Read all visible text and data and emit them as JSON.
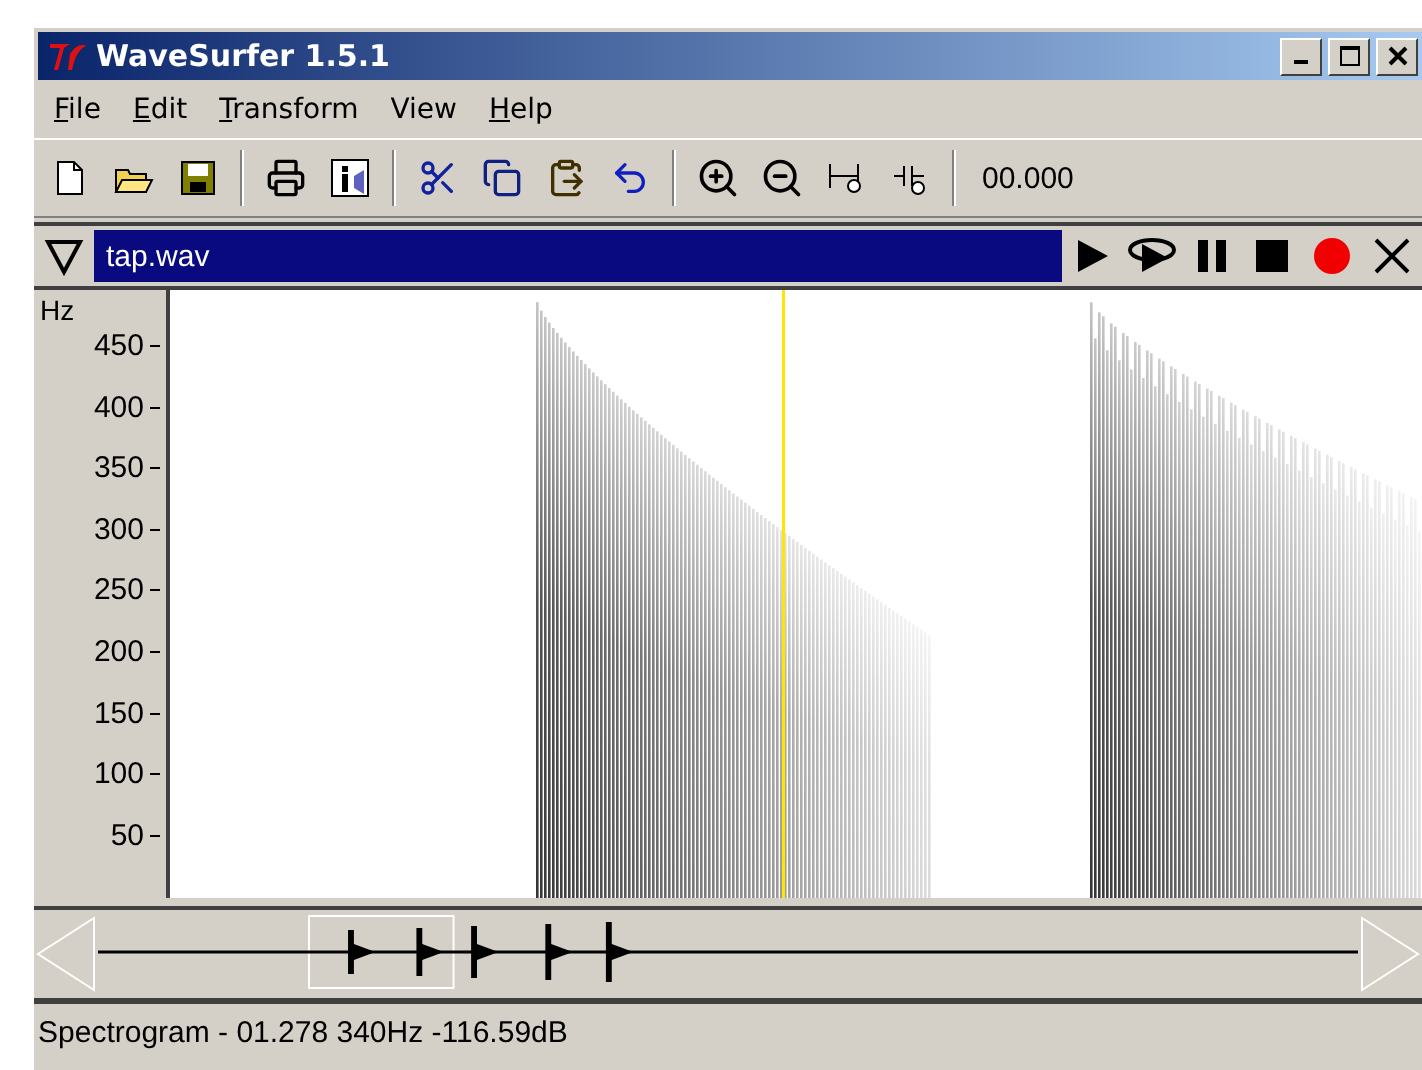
{
  "window": {
    "title": "WaveSurfer 1.5.1"
  },
  "menu": [
    {
      "label": "File",
      "mnemonic": true
    },
    {
      "label": "Edit",
      "mnemonic": true
    },
    {
      "label": "Transform",
      "mnemonic": true
    },
    {
      "label": "View",
      "mnemonic": false
    },
    {
      "label": "Help",
      "mnemonic": true
    }
  ],
  "toolbar": {
    "time": "00.000"
  },
  "track": {
    "title": "tap.wav",
    "expanded": true
  },
  "spectrogram": {
    "unit": "Hz",
    "ticks": [
      "450",
      "400",
      "350",
      "300",
      "250",
      "200",
      "150",
      "100",
      "50"
    ]
  },
  "status_bar": "Spectrogram - 01.278 340Hz -116.59dB"
}
